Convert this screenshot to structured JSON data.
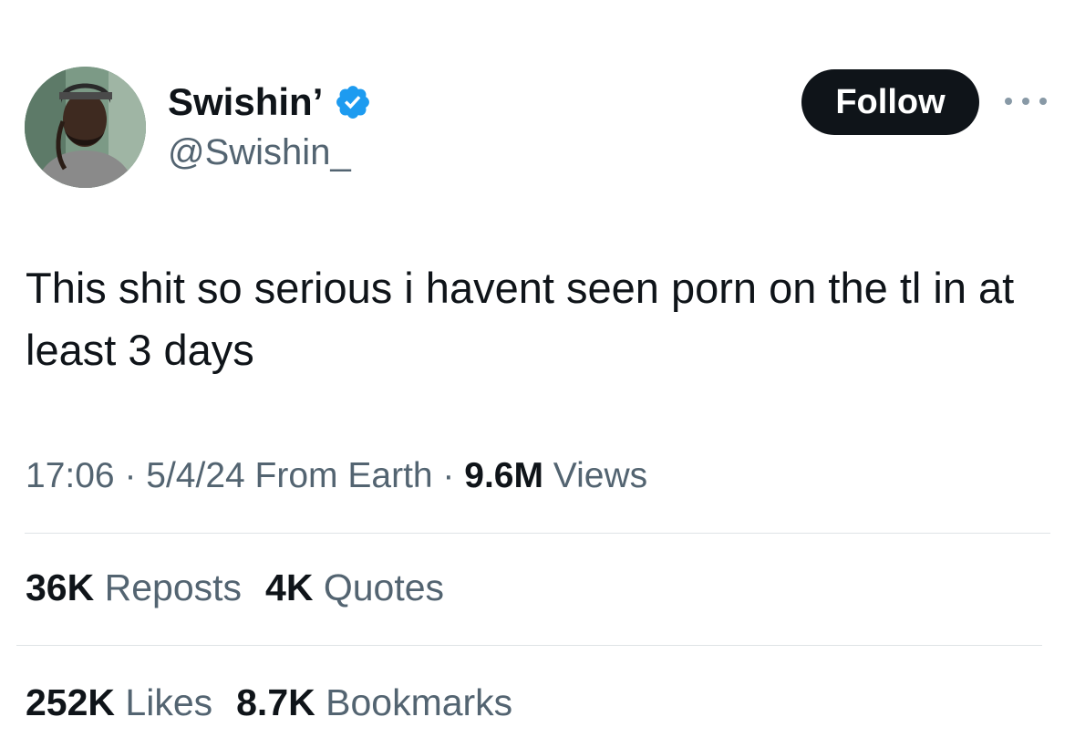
{
  "author": {
    "display_name": "Swishin’",
    "handle": "@Swishin_",
    "verified_icon": "verified-badge-icon",
    "avatar_icon": "profile-photo"
  },
  "actions": {
    "follow_label": "Follow",
    "more_icon": "more-options-icon"
  },
  "tweet": {
    "text": "This shit so serious i havent seen porn on the tl in at least 3 days"
  },
  "meta": {
    "time": "17:06",
    "sep1": " · ",
    "date": "5/4/24",
    "source": " From Earth",
    "sep2": " · ",
    "views_count": "9.6M",
    "views_label": " Views"
  },
  "stats": {
    "reposts_count": "36K",
    "reposts_label": " Reposts",
    "quotes_count": "4K",
    "quotes_label": " Quotes",
    "likes_count": "252K",
    "likes_label": " Likes",
    "bookmarks_count": "8.7K",
    "bookmarks_label": " Bookmarks"
  },
  "colors": {
    "text_primary": "#0f1419",
    "text_secondary": "#536471",
    "verified_blue": "#1d9bf0",
    "button_bg": "#0f1419",
    "divider": "#dfe3e6"
  }
}
